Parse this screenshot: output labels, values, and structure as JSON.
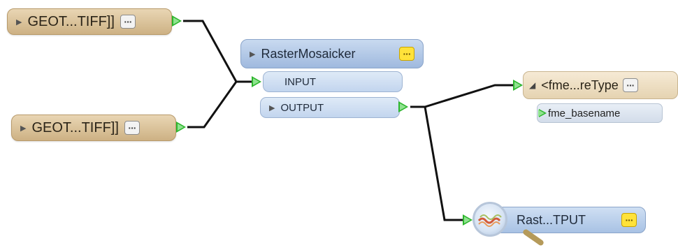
{
  "readers": [
    {
      "label": "GEOT...TIFF]]"
    },
    {
      "label": "GEOT...TIFF]]"
    }
  ],
  "mosaicker": {
    "title": "RasterMosaicker",
    "input_port": "INPUT",
    "output_port": "OUTPUT"
  },
  "writer": {
    "label": "<fme...reType",
    "attribute": "fme_basename"
  },
  "inspector": {
    "label": "Rast...TPUT"
  },
  "colors": {
    "wire": "#111111",
    "port_arrow": "#2db52d",
    "menu_yellow": "#ffe23a"
  }
}
